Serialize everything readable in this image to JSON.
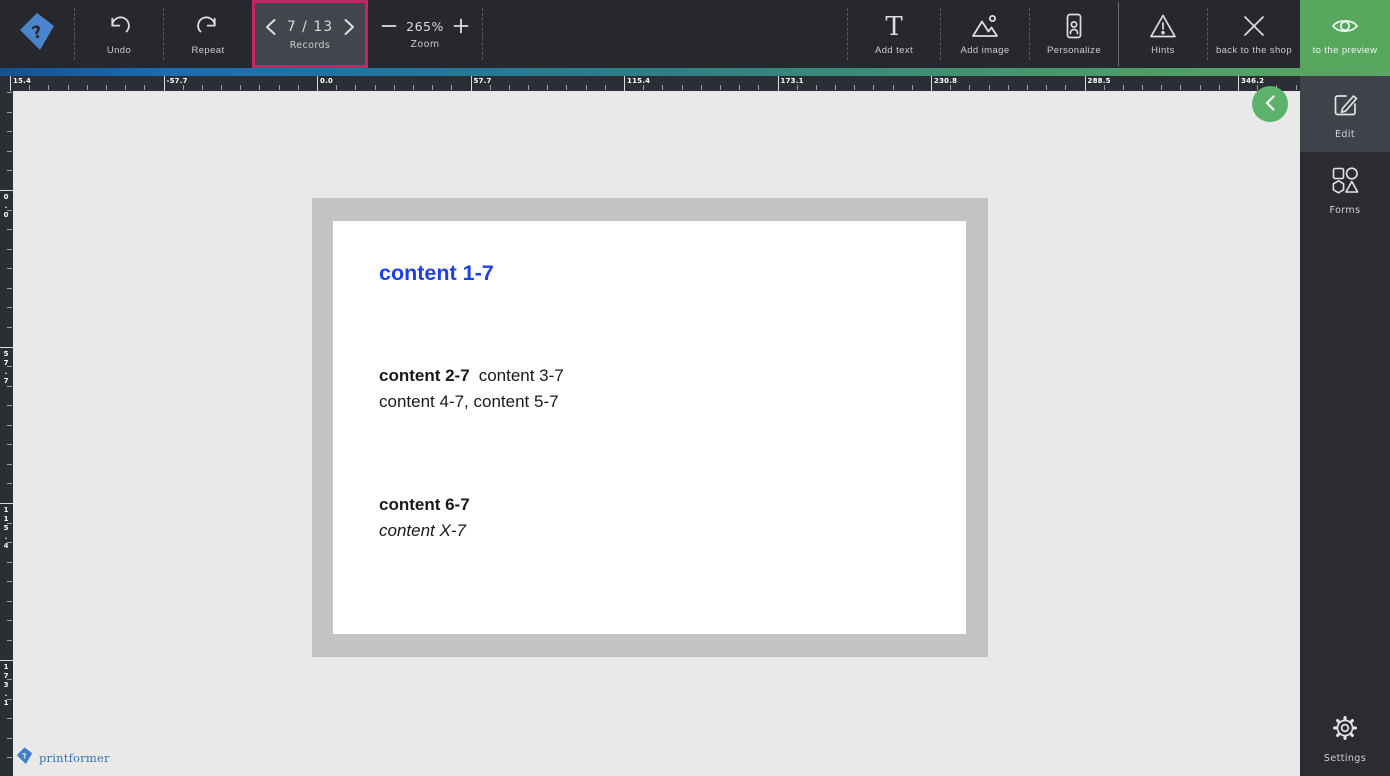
{
  "toolbar": {
    "undo_label": "Undo",
    "repeat_label": "Repeat",
    "records": {
      "value": "7 / 13",
      "label": "Records"
    },
    "zoom": {
      "value": "265%",
      "label": "Zoom"
    },
    "add_text_label": "Add text",
    "add_image_label": "Add image",
    "personalize_label": "Personalize",
    "hints_label": "Hints",
    "back_to_shop_label": "back to the shop",
    "to_preview_label": "to the preview"
  },
  "rulers": {
    "horizontal_labels": [
      "15.4",
      "-57.7",
      "0.0",
      "57.7",
      "115.4",
      "173.1",
      "230.8",
      "288.5",
      "346.2"
    ],
    "vertical_labels": [
      "0.0",
      "57.7",
      "115.4",
      "173.1"
    ]
  },
  "sidebar": {
    "edit_label": "Edit",
    "forms_label": "Forms",
    "settings_label": "Settings"
  },
  "document": {
    "heading": "content 1-7",
    "line2_bold": "content 2-7",
    "line2_regular": "content 3-7",
    "line3": "content 4-7, content 5-7",
    "line4": "content 6-7",
    "line5_italic": "content X-7"
  },
  "footer": {
    "brand": "printformer"
  },
  "colors": {
    "records_highlight": "#c9246a",
    "preview_green": "#57a75f",
    "heading_blue": "#1c40e6",
    "toolbar_bg": "#26282d"
  }
}
